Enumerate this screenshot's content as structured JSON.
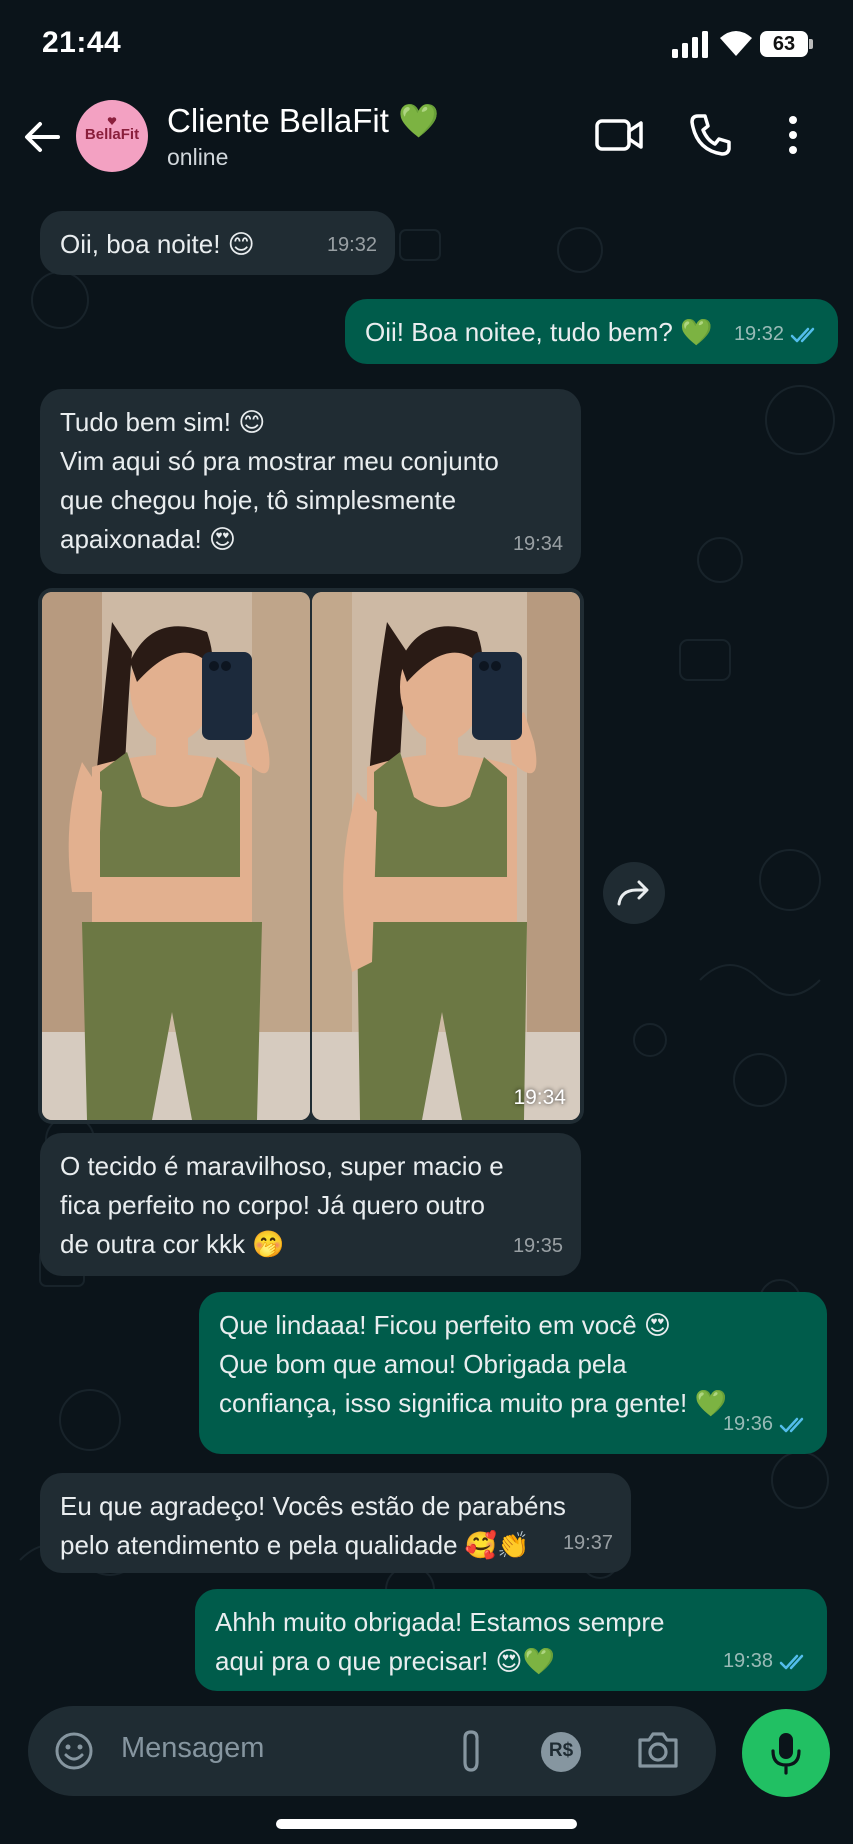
{
  "status_bar": {
    "time": "21:44",
    "battery": "63"
  },
  "header": {
    "avatar_text": "BellaFit",
    "contact_name": "Cliente BellaFit 💚",
    "contact_status": "online"
  },
  "messages": [
    {
      "direction": "in",
      "text": "Oii, boa noite! 😊",
      "time": "19:32"
    },
    {
      "direction": "out",
      "text": "Oii! Boa noitee, tudo bem? 💚",
      "time": "19:32",
      "read": true
    },
    {
      "direction": "in",
      "text": "Tudo bem sim! 😊\nVim aqui só pra mostrar meu conjunto\nque chegou hoje, tô simplesmente\napaixonada! 😍",
      "time": "19:34"
    },
    {
      "direction": "in",
      "type": "image",
      "time": "19:34"
    },
    {
      "direction": "in",
      "text": "O tecido é maravilhoso, super macio e\nfica perfeito no corpo! Já quero outro\nde outra cor kkk 🤭",
      "time": "19:35"
    },
    {
      "direction": "out",
      "text": "Que lindaaa! Ficou perfeito em você 😍\nQue bom que amou! Obrigada pela\nconfiança, isso significa muito pra gente! 💚",
      "time": "19:36",
      "read": true
    },
    {
      "direction": "in",
      "text": "Eu que agradeço! Vocês estão de parabéns\npelo atendimento e pela qualidade 🥰👏",
      "time": "19:37"
    },
    {
      "direction": "out",
      "text": "Ahhh muito obrigada! Estamos sempre\naqui pra o que precisar! 😍💚",
      "time": "19:38",
      "read": true
    }
  ],
  "input": {
    "placeholder": "Mensagem"
  },
  "icons": {
    "back": "back-arrow-icon",
    "video": "video-call-icon",
    "call": "phone-icon",
    "menu": "more-vert-icon",
    "emoji": "emoji-icon",
    "attach": "paperclip-icon",
    "payment": "currency-icon",
    "camera": "camera-icon",
    "mic": "microphone-icon",
    "forward": "forward-icon"
  },
  "colors": {
    "background": "#0b141a",
    "incoming": "#202c33",
    "outgoing": "#005c4b",
    "accent": "#21c063",
    "read_tick": "#53bdeb"
  },
  "payment_icon_text": "R$"
}
